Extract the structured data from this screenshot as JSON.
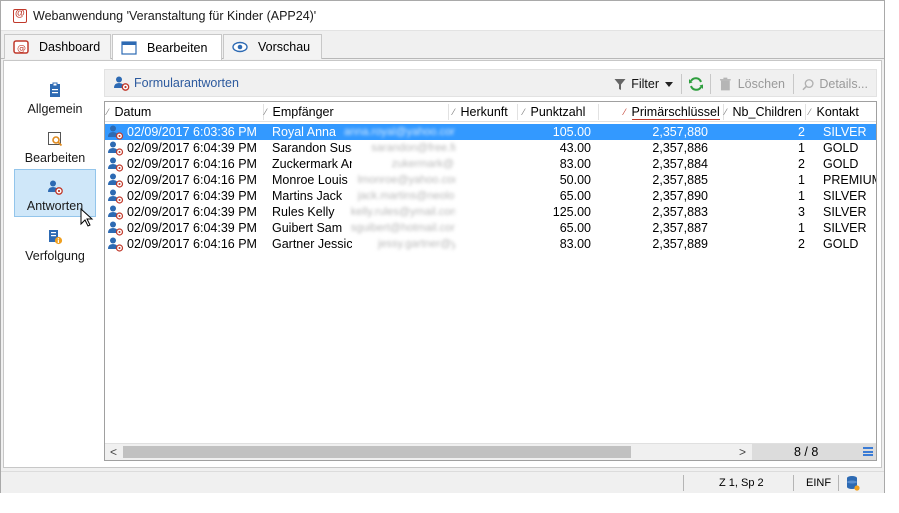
{
  "window": {
    "title": "Webanwendung 'Veranstaltung für Kinder (APP24)'"
  },
  "tabs": [
    {
      "label": "Dashboard",
      "icon": "app-icon"
    },
    {
      "label": "Bearbeiten",
      "icon": "window-icon"
    },
    {
      "label": "Vorschau",
      "icon": "eye-icon"
    }
  ],
  "nav": [
    {
      "label": "Allgemein",
      "icon": "clipboard-icon"
    },
    {
      "label": "Bearbeiten",
      "icon": "edit-form-icon"
    },
    {
      "label": "Antworten",
      "icon": "user-responses-icon"
    },
    {
      "label": "Verfolgung",
      "icon": "tracking-icon"
    }
  ],
  "toolbar": {
    "title": "Formularantworten",
    "filter_label": "Filter",
    "delete_label": "Löschen",
    "details_label": "Details..."
  },
  "grid": {
    "columns": [
      "Datum",
      "Empfänger",
      "Herkunft",
      "Punktzahl",
      "Primärschlüssel",
      "Nb_Children",
      "Kontakt"
    ],
    "rows": [
      {
        "date": "02/09/2017 6:03:36 PM",
        "name": "Royal Anna",
        "email": "anna.royal@yahoo.com",
        "score": "105.00",
        "key": "2,357,880",
        "children": "2",
        "contact": "SILVER"
      },
      {
        "date": "02/09/2017 6:04:39 PM",
        "name": "Sarandon Susan",
        "email": "sarandon@free.fr",
        "score": "43.00",
        "key": "2,357,886",
        "children": "1",
        "contact": "GOLD"
      },
      {
        "date": "02/09/2017 6:04:16 PM",
        "name": "Zuckermark Antony",
        "email": "zukermark@...",
        "score": "83.00",
        "key": "2,357,884",
        "children": "2",
        "contact": "GOLD"
      },
      {
        "date": "02/09/2017 6:04:16 PM",
        "name": "Monroe Louis",
        "email": "lmonroe@yahoo.com",
        "score": "50.00",
        "key": "2,357,885",
        "children": "1",
        "contact": "PREMIUM"
      },
      {
        "date": "02/09/2017 6:04:39 PM",
        "name": "Martins Jack",
        "email": "jack.martins@neolo...",
        "score": "65.00",
        "key": "2,357,890",
        "children": "1",
        "contact": "SILVER"
      },
      {
        "date": "02/09/2017 6:04:39 PM",
        "name": "Rules Kelly",
        "email": "kelly.rules@ymail.com",
        "score": "125.00",
        "key": "2,357,883",
        "children": "3",
        "contact": "SILVER"
      },
      {
        "date": "02/09/2017 6:04:39 PM",
        "name": "Guibert Sam",
        "email": "sguibert@hotmail.com",
        "score": "65.00",
        "key": "2,357,887",
        "children": "1",
        "contact": "SILVER"
      },
      {
        "date": "02/09/2017 6:04:16 PM",
        "name": "Gartner Jessica",
        "email": "jessy.gartner@ym...",
        "score": "83.00",
        "key": "2,357,889",
        "children": "2",
        "contact": "GOLD"
      }
    ],
    "pager": "8 / 8"
  },
  "status": {
    "position": "Z 1, Sp 2",
    "mode": "EINF"
  },
  "colors": {
    "selection": "#3399ff",
    "accent": "#2d5a9e",
    "nav_active": "#cfe7f9",
    "brand_red": "#c0392b"
  }
}
